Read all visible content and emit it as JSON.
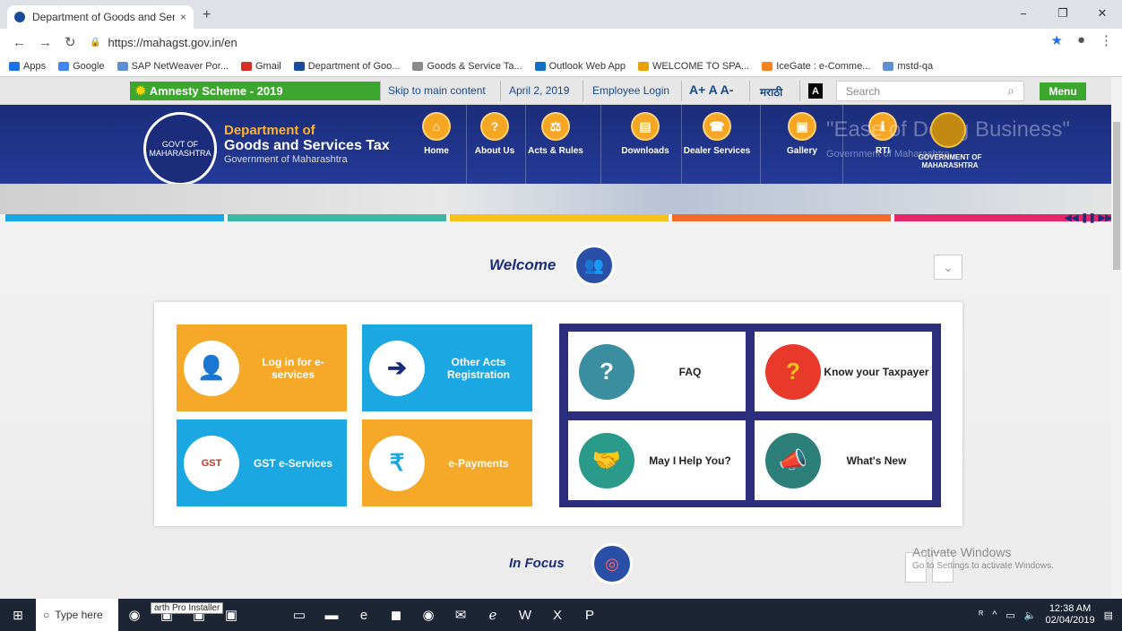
{
  "browser": {
    "tab_title": "Department of Goods and Servic",
    "tab_close": "×",
    "new_tab": "+",
    "url": "https://mahagst.gov.in/en",
    "win_min": "−",
    "win_max": "❐",
    "win_close": "✕"
  },
  "bookmarks": [
    {
      "label": "Apps",
      "color": "#1a73e8"
    },
    {
      "label": "Google",
      "color": "#4285f4"
    },
    {
      "label": "SAP NetWeaver Por...",
      "color": "#5c8fd6"
    },
    {
      "label": "Gmail",
      "color": "#d93025"
    },
    {
      "label": "Department of Goo...",
      "color": "#1a4a9c"
    },
    {
      "label": "Goods & Service Ta...",
      "color": "#8a8a8a"
    },
    {
      "label": "Outlook Web App",
      "color": "#0f6fc6"
    },
    {
      "label": "WELCOME TO SPA...",
      "color": "#e8a200"
    },
    {
      "label": "IceGate : e-Comme...",
      "color": "#f58220"
    },
    {
      "label": "mstd-qa",
      "color": "#5c8fd6"
    }
  ],
  "topbar": {
    "amnesty": "Amnesty Scheme - 2019",
    "skip": "Skip to main content",
    "date": "April 2, 2019",
    "employee_login": "Employee Login",
    "font_sizes": "A+ A A-",
    "marathi": "मराठी",
    "contrast": "A",
    "search_placeholder": "Search",
    "menu": "Menu"
  },
  "banner": {
    "dept_line1": "Department of",
    "dept_line2": "Goods and Services Tax",
    "dept_line3": "Government of Maharashtra",
    "nav": [
      "Home",
      "About Us",
      "Acts & Rules",
      "Downloads",
      "Dealer Services",
      "Gallery",
      "RTI"
    ],
    "eodb": "\"Ease of Doing Business\"",
    "gom_faint": "Government of Maharashtra",
    "gom_seal": "GOVERNMENT OF MAHARASHTRA"
  },
  "colors": {
    "stripe1": "#1aa7e2",
    "stripe2": "#3db7a5",
    "stripe3": "#f6c21c",
    "stripe4": "#f26b29",
    "stripe5": "#e5266a"
  },
  "welcome": "Welcome",
  "tiles": {
    "login": "Log in for e-services",
    "other_acts": "Other Acts Registration",
    "gst_eservices": "GST e-Services",
    "epayments": "e-Payments",
    "faq": "FAQ",
    "know_taxpayer": "Know your Taxpayer",
    "may_i_help": "May I Help You?",
    "whats_new": "What's New"
  },
  "in_focus": "In Focus",
  "watermark": {
    "line1": "Activate Windows",
    "line2": "Go to Settings to activate Windows."
  },
  "taskbar": {
    "search": "Type here",
    "tooltip": "arth Pro Installer",
    "time": "12:38 AM",
    "date": "02/04/2019"
  }
}
